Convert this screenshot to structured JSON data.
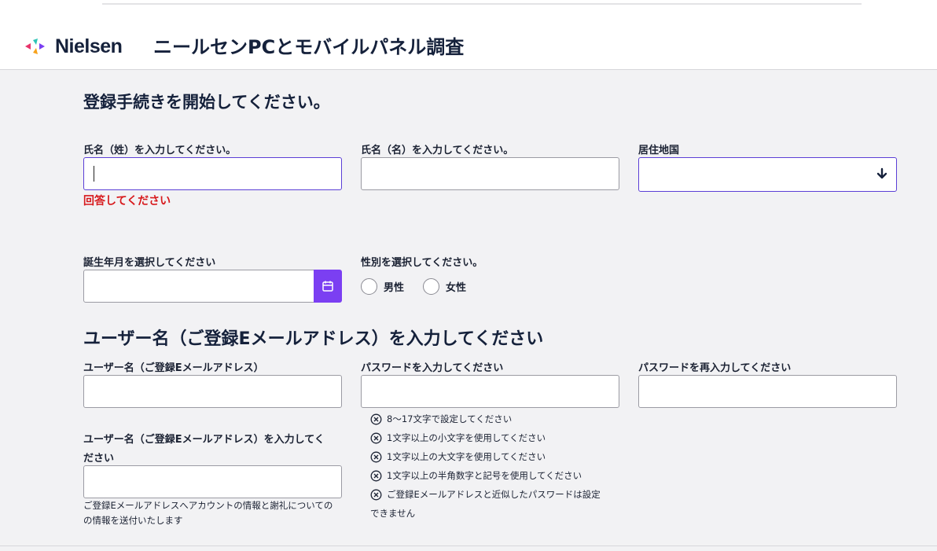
{
  "brand": {
    "name": "Nielsen"
  },
  "header": {
    "title": "ニールセンPCとモバイルパネル調査"
  },
  "section1": {
    "title": "登録手続きを開始してください。"
  },
  "last_name": {
    "label": "氏名（姓）を入力してください。",
    "value": "",
    "error": "回答してください"
  },
  "first_name": {
    "label": "氏名（名）を入力してください。",
    "value": ""
  },
  "country": {
    "label": "居住地国",
    "value": ""
  },
  "birth": {
    "label": "誕生年月を選択してください",
    "value": ""
  },
  "gender": {
    "label": "性別を選択してください。",
    "options": [
      "男性",
      "女性"
    ]
  },
  "section2": {
    "title": "ユーザー名（ご登録Eメールアドレス）を入力してください"
  },
  "username": {
    "label": "ユーザー名（ご登録Eメールアドレス）",
    "value": ""
  },
  "password": {
    "label": "パスワードを入力してください",
    "value": ""
  },
  "password_confirm": {
    "label": "パスワードを再入力してください",
    "value": ""
  },
  "username_confirm": {
    "label_line1": "ユーザー名（ご登録Eメールアドレス）を入力してく",
    "label_line2": "ださい",
    "value": "",
    "hint_line1": "ご登録Eメールアドレスへアカウントの情報と謝礼についての",
    "hint_line2": "の情報を送付いたします"
  },
  "password_rules": [
    "8〜17文字で設定してください",
    "1文字以上の小文字を使用してください",
    "1文字以上の大文字を使用してください",
    "1文字以上の半角数字と記号を使用してください",
    "ご登録Eメールアドレスと近似したパスワードは設定"
  ],
  "password_rules_cont": "できません",
  "colors": {
    "accent": "#7b3ff2",
    "error": "#d7191c",
    "focus": "#5b3fd6"
  },
  "icons": {
    "calendar": "calendar-icon",
    "dropdown": "arrow-down-icon",
    "rule": "circle-x-icon"
  }
}
